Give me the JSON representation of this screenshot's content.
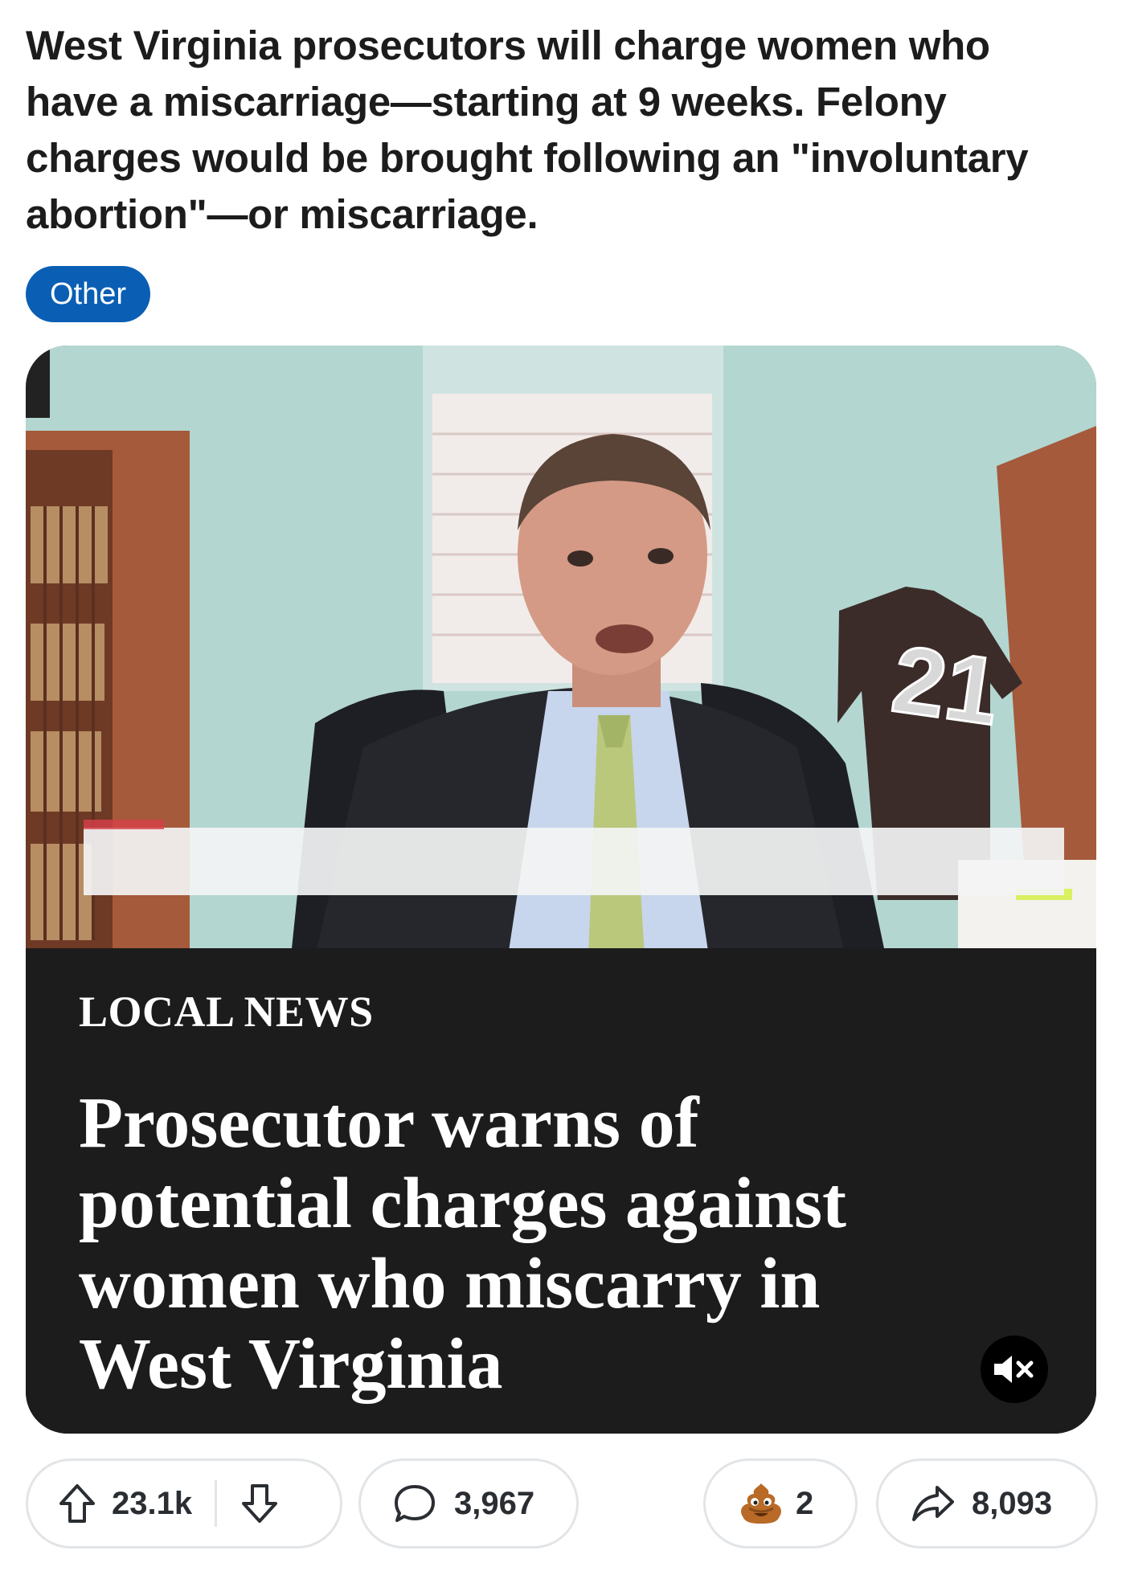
{
  "post": {
    "title": "West Virginia prosecutors will charge women who have a miscarriage—starting at 9 weeks. Felony charges would be brought following an \"involuntary abortion\"—or miscarriage.",
    "flair": "Other",
    "flair_color": "#0a5fb4"
  },
  "video": {
    "kicker": "LOCAL NEWS",
    "headline": "Prosecutor warns of potential charges against women who miscarry in West Virginia",
    "jersey_number": "21",
    "muted": true,
    "mute_icon": "speaker-muted-icon"
  },
  "actions": {
    "upvotes": "23.1k",
    "upvote_icon": "arrow-up-icon",
    "downvote_icon": "arrow-down-icon",
    "comments": "3,967",
    "comment_icon": "speech-bubble-icon",
    "awards": "2",
    "award_icon": "poop-emoji-icon",
    "shares": "8,093",
    "share_icon": "share-arrow-icon"
  }
}
